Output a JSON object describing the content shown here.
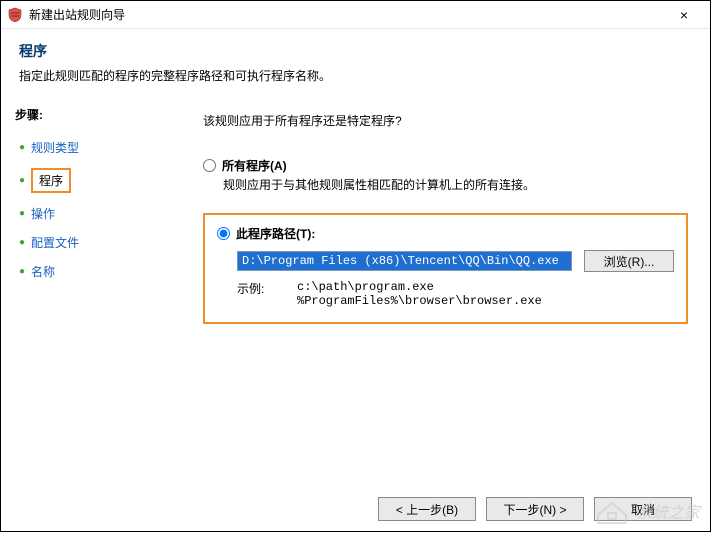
{
  "window": {
    "title": "新建出站规则向导",
    "close": "×"
  },
  "header": {
    "title": "程序",
    "subtitle": "指定此规则匹配的程序的完整程序路径和可执行程序名称。"
  },
  "sidebar": {
    "title": "步骤:",
    "items": [
      {
        "label": "规则类型"
      },
      {
        "label": "程序"
      },
      {
        "label": "操作"
      },
      {
        "label": "配置文件"
      },
      {
        "label": "名称"
      }
    ],
    "current_index": 1
  },
  "content": {
    "prompt": "该规则应用于所有程序还是特定程序?",
    "option_all": {
      "label": "所有程序(A)",
      "desc": "规则应用于与其他规则属性相匹配的计算机上的所有连接。"
    },
    "option_path": {
      "label": "此程序路径(T):",
      "value": "D:\\Program Files (x86)\\Tencent\\QQ\\Bin\\QQ.exe",
      "browse": "浏览(R)...",
      "example_label": "示例:",
      "example_line1": "c:\\path\\program.exe",
      "example_line2": "%ProgramFiles%\\browser\\browser.exe"
    }
  },
  "footer": {
    "back": "< 上一步(B)",
    "next": "下一步(N) >",
    "cancel": "取消"
  },
  "watermark": "系统之家"
}
